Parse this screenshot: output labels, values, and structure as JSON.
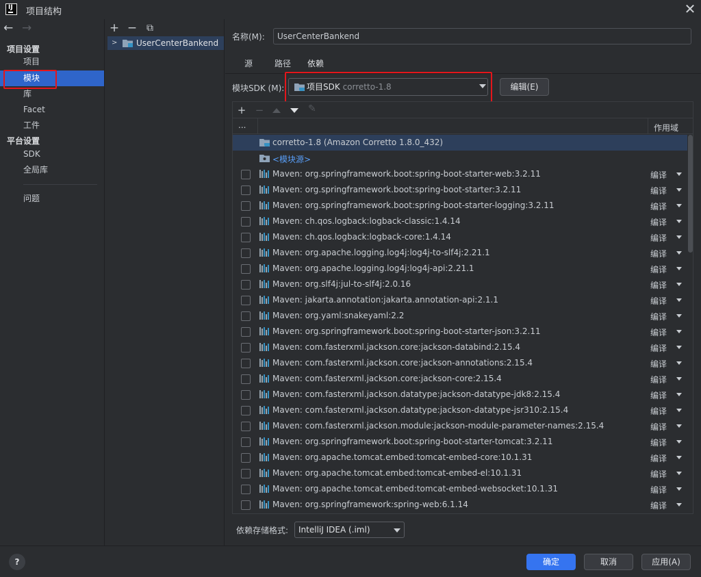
{
  "window": {
    "title": "项目结构",
    "logo_text": "IJ"
  },
  "nav": {
    "section_project": "项目设置",
    "section_platform": "平台设置",
    "items_project": [
      "项目",
      "模块",
      "库",
      "Facet",
      "工件"
    ],
    "items_platform": [
      "SDK",
      "全局库"
    ],
    "problems": "问题",
    "selected": "模块"
  },
  "tree": {
    "module": "UserCenterBankend"
  },
  "module": {
    "name_label": "名称(M):",
    "name_value": "UserCenterBankend",
    "tabs": [
      "源",
      "路径",
      "依赖"
    ],
    "active_tab": "依赖",
    "sdk_label": "模块SDK (M):",
    "sdk_value": "项目SDK",
    "sdk_value_hint": "corretto-1.8",
    "edit_button": "编辑(E)"
  },
  "deps_table": {
    "col_export": "...",
    "col_scope": "作用域",
    "sdk_row": "corretto-1.8 (Amazon Corretto 1.8.0_432)",
    "module_source_row": "<模块源>",
    "scope_default": "编译",
    "rows": [
      "Maven: org.springframework.boot:spring-boot-starter-web:3.2.11",
      "Maven: org.springframework.boot:spring-boot-starter:3.2.11",
      "Maven: org.springframework.boot:spring-boot-starter-logging:3.2.11",
      "Maven: ch.qos.logback:logback-classic:1.4.14",
      "Maven: ch.qos.logback:logback-core:1.4.14",
      "Maven: org.apache.logging.log4j:log4j-to-slf4j:2.21.1",
      "Maven: org.apache.logging.log4j:log4j-api:2.21.1",
      "Maven: org.slf4j:jul-to-slf4j:2.0.16",
      "Maven: jakarta.annotation:jakarta.annotation-api:2.1.1",
      "Maven: org.yaml:snakeyaml:2.2",
      "Maven: org.springframework.boot:spring-boot-starter-json:3.2.11",
      "Maven: com.fasterxml.jackson.core:jackson-databind:2.15.4",
      "Maven: com.fasterxml.jackson.core:jackson-annotations:2.15.4",
      "Maven: com.fasterxml.jackson.core:jackson-core:2.15.4",
      "Maven: com.fasterxml.jackson.datatype:jackson-datatype-jdk8:2.15.4",
      "Maven: com.fasterxml.jackson.datatype:jackson-datatype-jsr310:2.15.4",
      "Maven: com.fasterxml.jackson.module:jackson-module-parameter-names:2.15.4",
      "Maven: org.springframework.boot:spring-boot-starter-tomcat:3.2.11",
      "Maven: org.apache.tomcat.embed:tomcat-embed-core:10.1.31",
      "Maven: org.apache.tomcat.embed:tomcat-embed-el:10.1.31",
      "Maven: org.apache.tomcat.embed:tomcat-embed-websocket:10.1.31",
      "Maven: org.springframework:spring-web:6.1.14"
    ]
  },
  "storage": {
    "label": "依赖存储格式:",
    "value": "IntelliJ IDEA (.iml)"
  },
  "buttons": {
    "ok": "确定",
    "cancel": "取消",
    "apply": "应用(A)",
    "help": "?"
  },
  "icons": {
    "back": "arrow-left-icon",
    "forward": "arrow-right-icon",
    "add": "plus-icon",
    "remove": "minus-icon",
    "copy": "copy-icon",
    "close": "close-icon"
  },
  "colors": {
    "selection": "#2f65ca",
    "accent": "#3574f0",
    "highlight_box": "#e4161b",
    "link": "#589df6"
  }
}
